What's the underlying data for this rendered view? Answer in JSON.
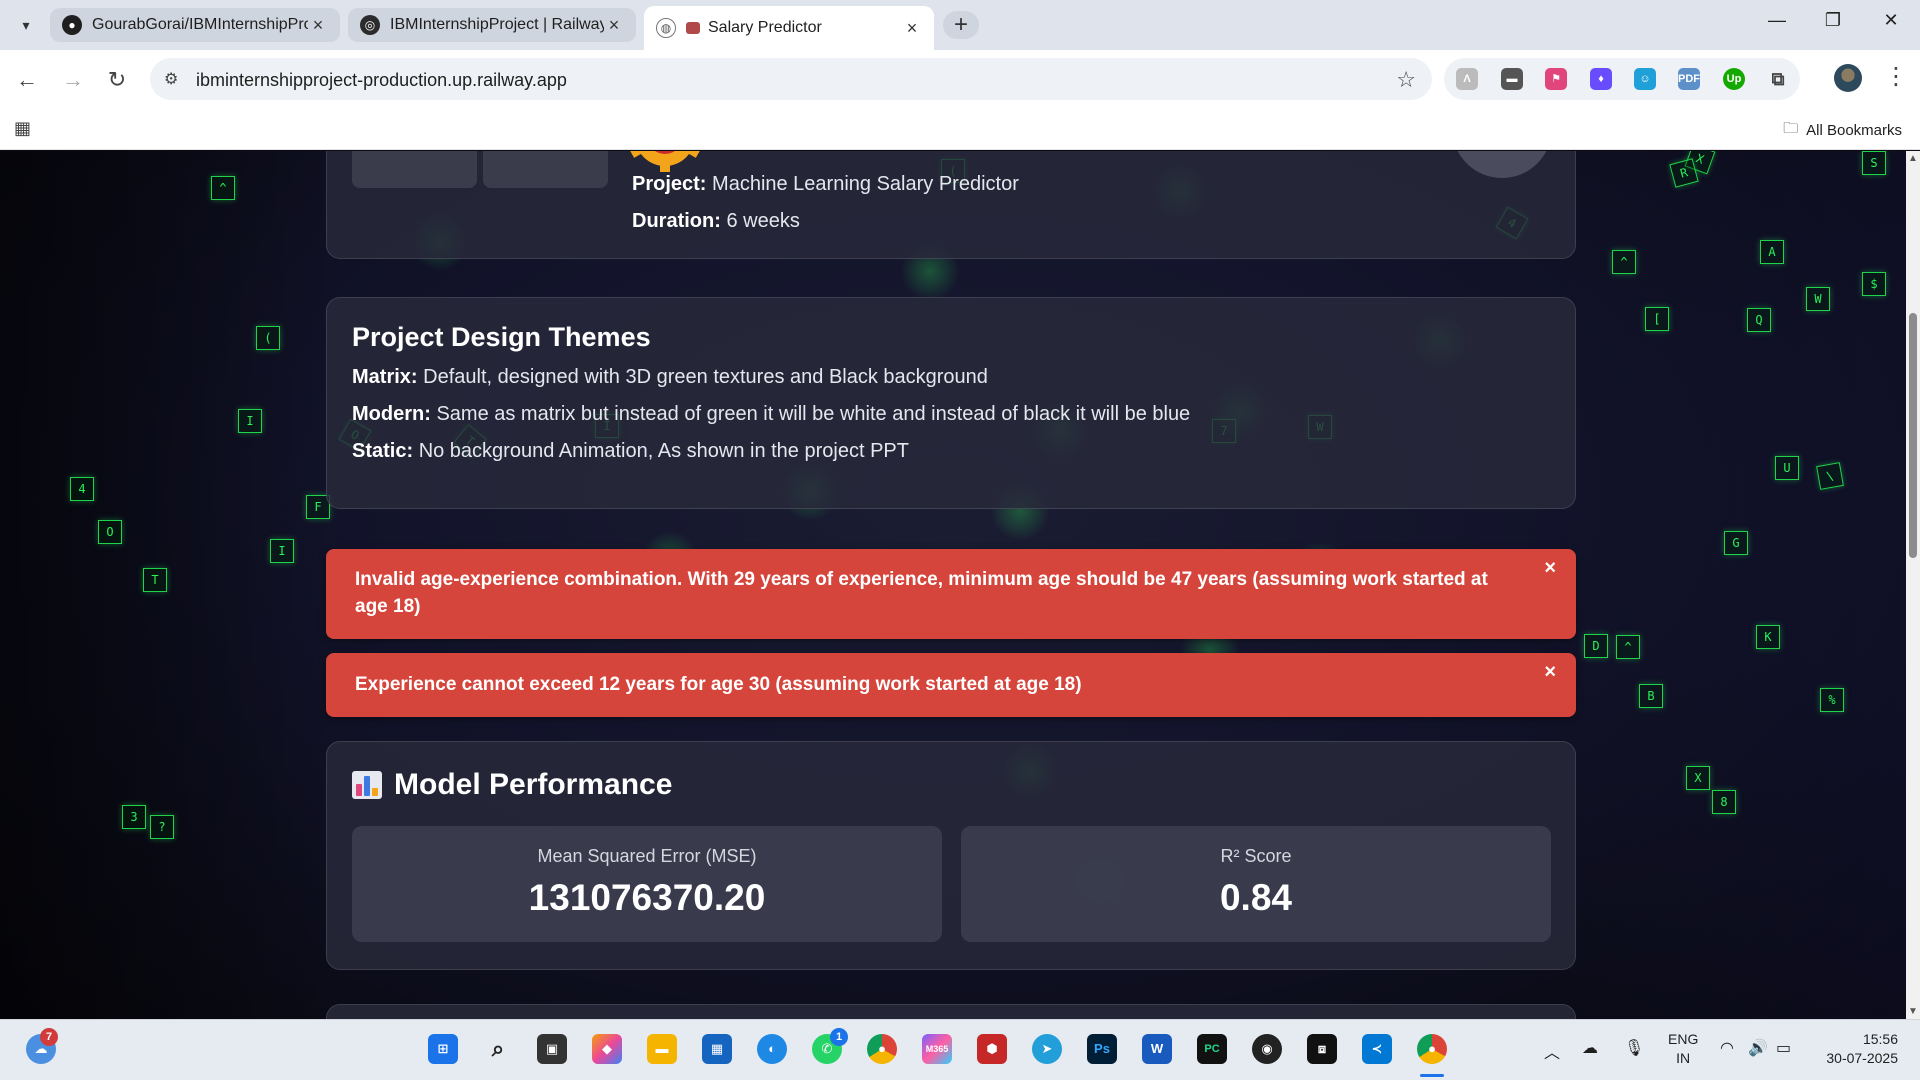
{
  "browser": {
    "tabs": [
      {
        "title": "GourabGorai/IBMInternshipProj",
        "favicon": "github-icon",
        "active": false
      },
      {
        "title": "IBMInternshipProject | Railway",
        "favicon": "railway-icon",
        "active": false
      },
      {
        "title": "Salary Predictor",
        "favicon": "globe-icon",
        "active": true
      }
    ],
    "url": "ibminternshipproject-production.up.railway.app",
    "bookmarks_label": "All Bookmarks",
    "extension_pdf": "PDF",
    "extension_up": "Up"
  },
  "page": {
    "info": {
      "project_label": "Project:",
      "project_value": "Machine Learning Salary Predictor",
      "duration_label": "Duration:",
      "duration_value": "6 weeks"
    },
    "themes": {
      "title": "Project Design Themes",
      "items": [
        {
          "label": "Matrix:",
          "text": "Default, designed with 3D green textures and Black background"
        },
        {
          "label": "Modern:",
          "text": "Same as matrix but instead of green it will be white and instead of black it will be blue"
        },
        {
          "label": "Static:",
          "text": "No background Animation, As shown in the project PPT"
        }
      ]
    },
    "alerts": [
      {
        "text": "Invalid age-experience combination. With 29 years of experience, minimum age should be 47 years (assuming work started at age 18)",
        "close": "×"
      },
      {
        "text": "Experience cannot exceed 12 years for age 30 (assuming work started at age 18)",
        "close": "×"
      }
    ],
    "performance": {
      "title": "Model Performance",
      "metrics": [
        {
          "label": "Mean Squared Error (MSE)",
          "value": "131076370.20"
        },
        {
          "label": "R² Score",
          "value": "0.84"
        }
      ]
    },
    "matrix_glyphs": [
      "^",
      "(",
      "I",
      "4",
      "O",
      "T",
      "3",
      "?",
      "W",
      "S",
      "X",
      "R",
      "A",
      "$",
      "^",
      "[",
      "Q",
      "U",
      "\\",
      "G",
      "D",
      "K",
      "B",
      "%",
      "X",
      "8",
      "7",
      "W",
      "F",
      "I"
    ]
  },
  "taskbar": {
    "weather_badge": "7",
    "whatsapp_badge": "1",
    "lang_line1": "ENG",
    "lang_line2": "IN",
    "time": "15:56",
    "date": "30-07-2025",
    "app_m365": "M365",
    "app_ps": "Ps",
    "app_word": "W",
    "app_pc": "PC"
  },
  "colors": {
    "alert_red": "#d6453c",
    "matrix_green": "#2af05a",
    "card_bg": "#282a3a"
  }
}
